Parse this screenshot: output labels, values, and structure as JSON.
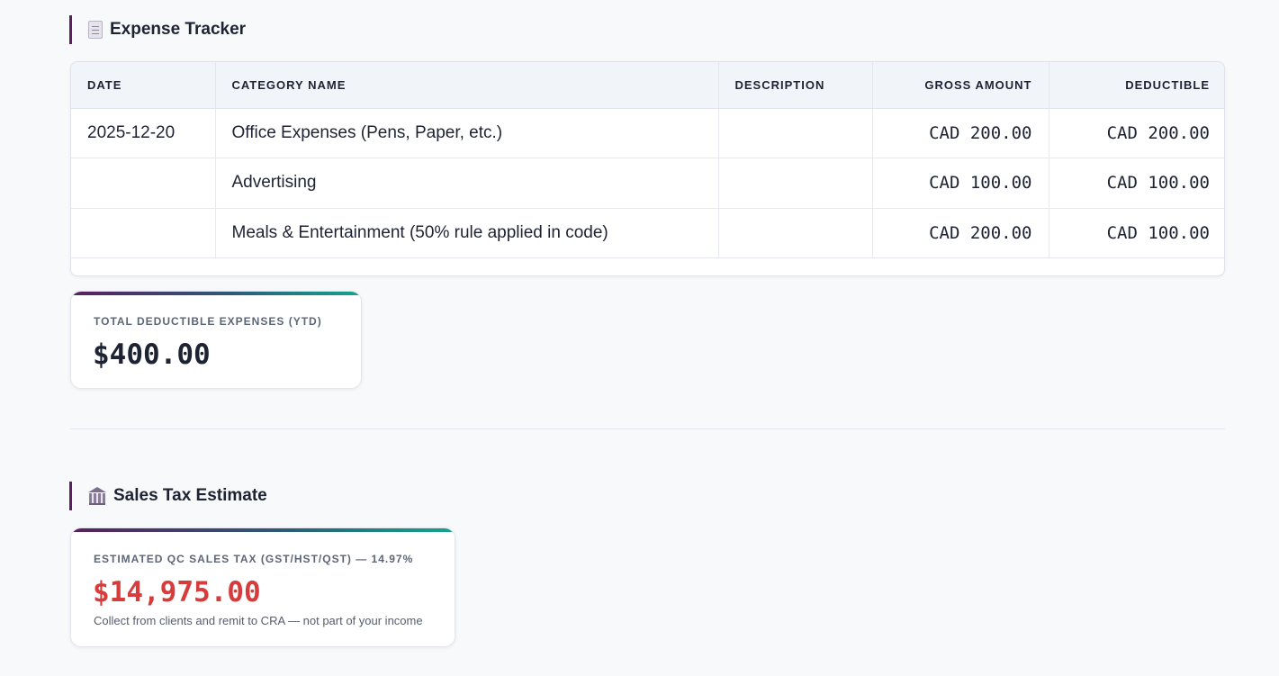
{
  "expense_section": {
    "title": "Expense Tracker",
    "icon": "receipt-icon",
    "table": {
      "headers": [
        "DATE",
        "CATEGORY NAME",
        "DESCRIPTION",
        "GROSS AMOUNT",
        "DEDUCTIBLE"
      ],
      "rows": [
        {
          "date": "2025-12-20",
          "category": "Office Expenses (Pens, Paper, etc.)",
          "description": "",
          "gross": "CAD 200.00",
          "deductible": "CAD 200.00"
        },
        {
          "date": "",
          "category": "Advertising",
          "description": "",
          "gross": "CAD 100.00",
          "deductible": "CAD 100.00"
        },
        {
          "date": "",
          "category": "Meals & Entertainment (50% rule applied in code)",
          "description": "",
          "gross": "CAD 200.00",
          "deductible": "CAD 100.00"
        }
      ]
    },
    "total_card": {
      "label": "TOTAL DEDUCTIBLE EXPENSES (YTD)",
      "value": "$400.00",
      "value_color": "#1e2333"
    }
  },
  "sales_tax_section": {
    "title": "Sales Tax Estimate",
    "icon": "bank-icon",
    "card": {
      "label": "ESTIMATED QC SALES TAX (GST/HST/QST) — 14.97%",
      "value": "$14,975.00",
      "value_color": "#d63c3c",
      "note": "Collect from clients and remit to CRA — not part of your income"
    }
  },
  "colors": {
    "accent": "#5a1f5e",
    "gradient_end": "#12a48f",
    "background": "#f8f9fb"
  }
}
